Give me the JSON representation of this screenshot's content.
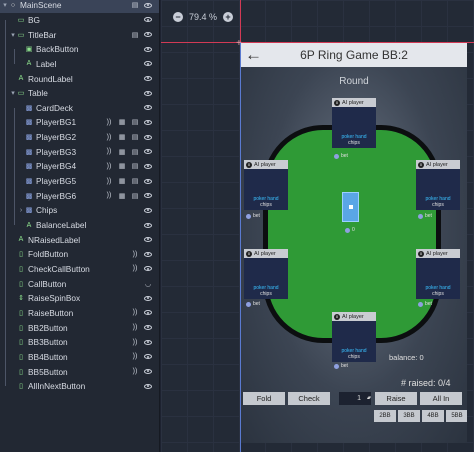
{
  "tree": {
    "nodes": [
      {
        "label": "MainScene",
        "icon": "node-icon",
        "indent": 0,
        "arrow": "▾",
        "selected": true,
        "actions": [
          "script-icon",
          "eye-icon"
        ]
      },
      {
        "label": "BG",
        "icon": "panel-icon",
        "indent": 1,
        "arrow": "",
        "actions": [
          "eye-icon"
        ]
      },
      {
        "label": "TitleBar",
        "icon": "panel-icon",
        "indent": 1,
        "arrow": "▾",
        "actions": [
          "script-icon",
          "eye-icon"
        ]
      },
      {
        "label": "BackButton",
        "icon": "texture-button-icon",
        "indent": 2,
        "arrow": "",
        "actions": [
          "eye-icon"
        ]
      },
      {
        "label": "Label",
        "icon": "label-icon",
        "indent": 2,
        "arrow": "",
        "actions": [
          "eye-icon"
        ]
      },
      {
        "label": "RoundLabel",
        "icon": "label-icon",
        "indent": 1,
        "arrow": "",
        "actions": [
          "eye-icon"
        ]
      },
      {
        "label": "Table",
        "icon": "panel-icon",
        "indent": 1,
        "arrow": "▾",
        "actions": [
          "eye-icon"
        ]
      },
      {
        "label": "CardDeck",
        "icon": "texture-rect-icon",
        "indent": 2,
        "arrow": "",
        "actions": [
          "eye-icon"
        ]
      },
      {
        "label": "PlayerBG1",
        "icon": "texture-rect-icon",
        "indent": 2,
        "arrow": "",
        "actions": [
          "signal-icon",
          "group-icon",
          "script-icon",
          "eye-icon"
        ]
      },
      {
        "label": "PlayerBG2",
        "icon": "texture-rect-icon",
        "indent": 2,
        "arrow": "",
        "actions": [
          "signal-icon",
          "group-icon",
          "script-icon",
          "eye-icon"
        ]
      },
      {
        "label": "PlayerBG3",
        "icon": "texture-rect-icon",
        "indent": 2,
        "arrow": "",
        "actions": [
          "signal-icon",
          "group-icon",
          "script-icon",
          "eye-icon"
        ]
      },
      {
        "label": "PlayerBG4",
        "icon": "texture-rect-icon",
        "indent": 2,
        "arrow": "",
        "actions": [
          "signal-icon",
          "group-icon",
          "script-icon",
          "eye-icon"
        ]
      },
      {
        "label": "PlayerBG5",
        "icon": "texture-rect-icon",
        "indent": 2,
        "arrow": "",
        "actions": [
          "signal-icon",
          "group-icon",
          "script-icon",
          "eye-icon"
        ]
      },
      {
        "label": "PlayerBG6",
        "icon": "texture-rect-icon",
        "indent": 2,
        "arrow": "",
        "actions": [
          "signal-icon",
          "group-icon",
          "script-icon",
          "eye-icon"
        ]
      },
      {
        "label": "Chips",
        "icon": "texture-rect-icon",
        "indent": 2,
        "arrow": "›",
        "actions": [
          "eye-icon"
        ]
      },
      {
        "label": "BalanceLabel",
        "icon": "label-icon",
        "indent": 2,
        "arrow": "",
        "actions": [
          "eye-icon"
        ]
      },
      {
        "label": "NRaisedLabel",
        "icon": "label-icon",
        "indent": 1,
        "arrow": "",
        "actions": [
          "eye-icon"
        ]
      },
      {
        "label": "FoldButton",
        "icon": "button-icon",
        "indent": 1,
        "arrow": "",
        "actions": [
          "signal-icon",
          "eye-icon"
        ]
      },
      {
        "label": "CheckCallButton",
        "icon": "button-icon",
        "indent": 1,
        "arrow": "",
        "actions": [
          "signal-icon",
          "eye-icon"
        ]
      },
      {
        "label": "CallButton",
        "icon": "button-icon",
        "indent": 1,
        "arrow": "",
        "actions": [
          "hidden-eye-icon"
        ]
      },
      {
        "label": "RaiseSpinBox",
        "icon": "spinbox-icon",
        "indent": 1,
        "arrow": "",
        "actions": [
          "eye-icon"
        ]
      },
      {
        "label": "RaiseButton",
        "icon": "button-icon",
        "indent": 1,
        "arrow": "",
        "actions": [
          "signal-icon",
          "eye-icon"
        ]
      },
      {
        "label": "BB2Button",
        "icon": "button-icon",
        "indent": 1,
        "arrow": "",
        "actions": [
          "signal-icon",
          "eye-icon"
        ]
      },
      {
        "label": "BB3Button",
        "icon": "button-icon",
        "indent": 1,
        "arrow": "",
        "actions": [
          "signal-icon",
          "eye-icon"
        ]
      },
      {
        "label": "BB4Button",
        "icon": "button-icon",
        "indent": 1,
        "arrow": "",
        "actions": [
          "signal-icon",
          "eye-icon"
        ]
      },
      {
        "label": "BB5Button",
        "icon": "button-icon",
        "indent": 1,
        "arrow": "",
        "actions": [
          "signal-icon",
          "eye-icon"
        ]
      },
      {
        "label": "AllInNextButton",
        "icon": "button-icon",
        "indent": 1,
        "arrow": "",
        "actions": [
          "eye-icon"
        ]
      }
    ]
  },
  "viewport": {
    "zoom_out": "−",
    "zoom_level": "79.4 %",
    "zoom_in": "+",
    "origin_marker": "+"
  },
  "game": {
    "back_arrow": "←",
    "title": "6P Ring Game BB:2",
    "round_label": "Round",
    "players": [
      {
        "name": "AI player",
        "badge": "0",
        "hand": "poker hand",
        "chips": "chips",
        "bet": "bet"
      },
      {
        "name": "AI player",
        "badge": "0",
        "hand": "poker hand",
        "chips": "chips",
        "bet": "bet"
      },
      {
        "name": "AI player",
        "badge": "0",
        "hand": "poker hand",
        "chips": "chips",
        "bet": "bet"
      },
      {
        "name": "AI player",
        "badge": "0",
        "hand": "poker hand",
        "chips": "chips",
        "bet": "bet"
      },
      {
        "name": "AI player",
        "badge": "0",
        "hand": "poker hand",
        "chips": "chips",
        "bet": "bet"
      },
      {
        "name": "AI player",
        "badge": "0",
        "hand": "poker hand",
        "chips": "chips",
        "bet": "bet"
      }
    ],
    "deck_count": "0",
    "balance": "balance: 0",
    "n_raised": "# raised: 0/4",
    "buttons": {
      "fold": "Fold",
      "check": "Check",
      "raise_value": "1",
      "raise": "Raise",
      "all_in": "All In",
      "bb2": "2BB",
      "bb3": "3BB",
      "bb4": "4BB",
      "bb5": "5BB"
    },
    "colors": {
      "table_felt": "#2f9a36",
      "player_panel": "#1f2a4a",
      "hand_text": "#3ac0ff"
    }
  }
}
